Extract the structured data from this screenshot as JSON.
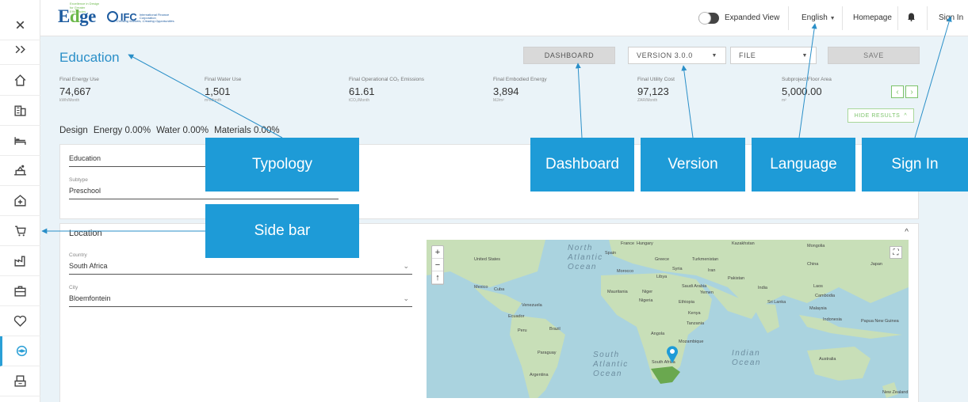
{
  "sidebar": {
    "items": [
      {
        "icon": "close-icon",
        "glyph": "✕"
      },
      {
        "icon": "expand-icon",
        "glyph": "»"
      },
      {
        "icon": "home-icon"
      },
      {
        "icon": "building-icon"
      },
      {
        "icon": "bed-icon"
      },
      {
        "icon": "retail-icon"
      },
      {
        "icon": "hospital-icon"
      },
      {
        "icon": "shopping-cart-icon"
      },
      {
        "icon": "industrial-icon"
      },
      {
        "icon": "office-icon"
      },
      {
        "icon": "heart-icon"
      },
      {
        "icon": "education-icon",
        "active": true
      },
      {
        "icon": "mixed-use-icon"
      }
    ]
  },
  "topbar": {
    "logo_edge": "Edge",
    "logo_edge_tagline": "Excellence in Design for Greater Efficiencies",
    "logo_ifc": "IFC",
    "logo_ifc_text": "International Finance Corporation",
    "logo_tagline": "Creating Markets, Creating Opportunities",
    "expanded_view": "Expanded View",
    "language": "English",
    "homepage": "Homepage",
    "sign_in": "Sign In"
  },
  "header": {
    "title": "Education",
    "dashboard": "DASHBOARD",
    "version": "VERSION 3.0.0",
    "file": "FILE",
    "save": "SAVE"
  },
  "metrics": [
    {
      "label": "Final Energy Use",
      "value": "74,667",
      "unit": "kWh/Month"
    },
    {
      "label": "Final Water Use",
      "value": "1,501",
      "unit": "m³/Month"
    },
    {
      "label": "Final Operational CO₂ Emissions",
      "value": "61.61",
      "unit": "tCO₂/Month"
    },
    {
      "label": "Final Embodied Energy",
      "value": "3,894",
      "unit": "MJ/m²"
    },
    {
      "label": "Final Utility Cost",
      "value": "97,123",
      "unit": "ZAR/Month"
    },
    {
      "label": "Subproject Floor Area",
      "value": "5,000.00",
      "unit": "m²"
    }
  ],
  "pager": {
    "prev": "‹",
    "next": "›"
  },
  "hide_results": "HIDE RESULTS",
  "tabs": {
    "design": "Design",
    "energy": "Energy 0.00%",
    "water": "Water 0.00%",
    "materials": "Materials 0.00%"
  },
  "typology_card": {
    "typology_value": "Education",
    "subtype_label": "Subtype",
    "subtype_value": "Preschool"
  },
  "location_card": {
    "title": "Location",
    "country_label": "Country",
    "country_value": "South Africa",
    "city_label": "City",
    "city_value": "Bloemfontein"
  },
  "map": {
    "zoom_in": "+",
    "zoom_out": "−",
    "reset": "↑",
    "fullscreen": "⛶",
    "oceans": [
      {
        "text": "North\nAtlantic\nOcean"
      },
      {
        "text": "South\nAtlantic\nOcean"
      },
      {
        "text": "Indian\nOcean"
      }
    ],
    "labels": [
      "United States",
      "France",
      "Hungary",
      "Kazakhstan",
      "Mongolia",
      "Spain",
      "Greece",
      "Turkmenistan",
      "China",
      "Japan",
      "Iran",
      "Syria",
      "Morocco",
      "Libya",
      "Pakistan",
      "Mexico",
      "Cuba",
      "Mauritania",
      "Niger",
      "Saudi Arabia",
      "India",
      "Laos",
      "Yemen",
      "Nigeria",
      "Ethiopia",
      "Sri Lanka",
      "Cambodia",
      "Malaysia",
      "Venezuela",
      "Kenya",
      "Ecuador",
      "Tanzania",
      "Indonesia",
      "Papua New Guinea",
      "Brazil",
      "Peru",
      "Angola",
      "Mozambique",
      "Paraguay",
      "South Africa",
      "Australia",
      "Argentina",
      "New Zealand"
    ]
  },
  "annotations": {
    "typology": "Typology",
    "sidebar": "Side bar",
    "dashboard": "Dashboard",
    "version": "Version",
    "language": "Language",
    "sign_in": "Sign In"
  },
  "colors": {
    "accent": "#2a8fc8",
    "annotation": "#1e9bd7",
    "green": "#7cc36a",
    "background": "#eaf3f8"
  }
}
